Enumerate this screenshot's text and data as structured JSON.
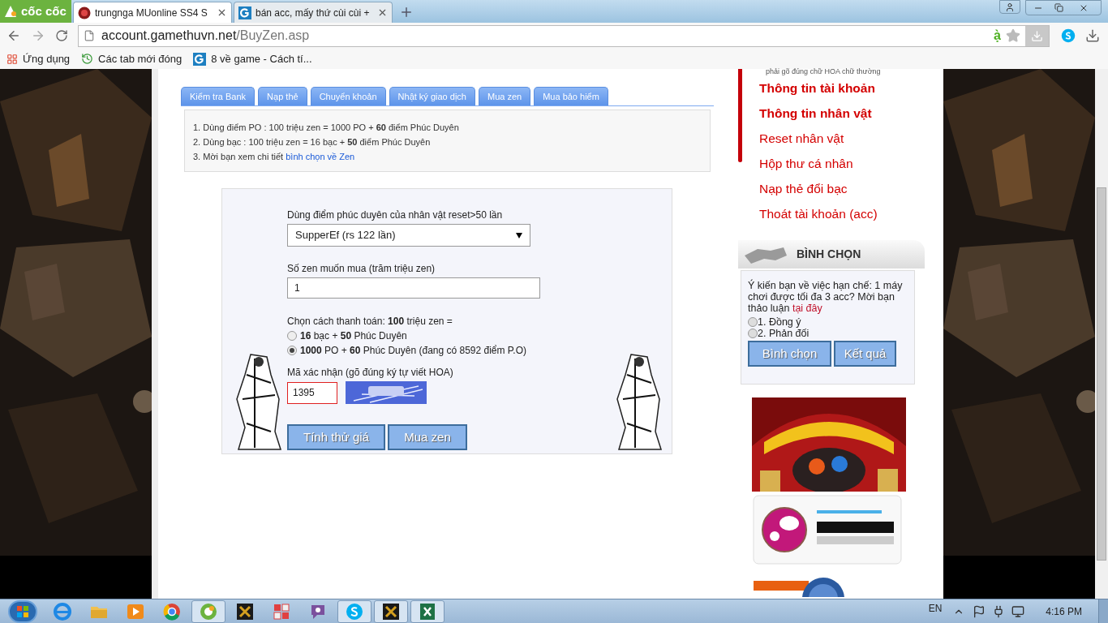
{
  "browser": {
    "logo": "cốc cốc",
    "tabs": [
      {
        "title": "trungnga MUonline SS4 S",
        "selected": true,
        "kind": "game"
      },
      {
        "title": "bán acc, mấy thứ cùi cùi +",
        "selected": false,
        "kind": "g"
      }
    ],
    "address": {
      "host": "account.gamethuvn.net",
      "path": "/BuyZen.asp"
    },
    "ime_indicator": "ạ̀",
    "bookmarks": [
      {
        "label": "Ứng dụng",
        "kind": "apps"
      },
      {
        "label": "Các tab mới đóng",
        "kind": "history"
      },
      {
        "label": "8 về game - Cách tí...",
        "kind": "g"
      }
    ]
  },
  "page_tabs": [
    {
      "label": "Kiểm tra Bank",
      "selected": false
    },
    {
      "label": "Nạp thẻ",
      "selected": false
    },
    {
      "label": "Chuyển khoản",
      "selected": false
    },
    {
      "label": "Nhật ký giao dịch",
      "selected": false
    },
    {
      "label": "Mua zen",
      "selected": false
    },
    {
      "label": "Mua bảo hiểm",
      "selected": false
    }
  ],
  "info": {
    "lines": [
      {
        "text": "1. Dùng điểm PO : 100 triệu zen = 1000 PO +  **60** điểm Phúc Duyên"
      },
      {
        "text": "2. Dùng bạc : 100 triệu zen = 16 bạc + **50** điểm Phúc Duyên"
      },
      {
        "text": "3. Mời bạn xem chi tiết",
        "link": "bình chọn về Zen"
      }
    ]
  },
  "form": {
    "character": {
      "label": "Dùng điểm phúc duyên của nhân vật reset>50 lần",
      "value": "SupperEf (rs 122 lần)"
    },
    "amount": {
      "label": "Số zen muốn mua (trăm triệu zen)",
      "value": "1"
    },
    "payment": {
      "label": "Chọn cách thanh toán: **100** triệu zen =",
      "options": [
        {
          "text": "**16** bạc + **50** Phúc Duyên",
          "selected": false
        },
        {
          "text": "**1000** PO + **60** Phúc Duyên (đang có 8592 điểm P.O)",
          "selected": true
        }
      ]
    },
    "captcha": {
      "label": "Mã xác nhận (gõ đúng ký tự viết HOA)",
      "value": "1395"
    },
    "buttons": [
      "Tính thử giá",
      "Mua zen"
    ]
  },
  "sidebar": {
    "note": "phải gõ đúng chữ HOA chữ thường",
    "menu": [
      {
        "label": "Thông tin tài khoản",
        "bold": true
      },
      {
        "label": "Thông tin nhân vật",
        "bold": true
      },
      {
        "label": "Reset nhân vật",
        "bold": false
      },
      {
        "label": "Hộp thư cá nhân",
        "bold": false
      },
      {
        "label": "Nạp thẻ đổi bạc",
        "bold": false
      },
      {
        "label": "Thoát tài khoản (acc)",
        "bold": false
      }
    ],
    "poll": {
      "title": "BÌNH CHỌN",
      "question": "Ý kiến bạn về việc hạn chế: 1 máy chơi được tối đa 3 acc? Mời bạn thảo luận",
      "link": "tại đây",
      "options": [
        {
          "label": "1. Đồng ý",
          "selected": false
        },
        {
          "label": "2. Phản đối",
          "selected": false
        }
      ],
      "buttons": [
        "Bình chọn",
        "Kết quả"
      ]
    }
  },
  "taskbar": {
    "apps": [
      {
        "kind": "ie",
        "active": false
      },
      {
        "kind": "folder",
        "active": false
      },
      {
        "kind": "media",
        "active": false
      },
      {
        "kind": "chrome",
        "active": false
      },
      {
        "kind": "coccoc",
        "active": true
      },
      {
        "kind": "game",
        "active": false
      },
      {
        "kind": "grid",
        "active": false
      },
      {
        "kind": "viber",
        "active": false
      },
      {
        "kind": "skype",
        "active": true
      },
      {
        "kind": "game",
        "active": true
      },
      {
        "kind": "excel",
        "active": true
      }
    ],
    "language": "EN",
    "time": "4:16 PM"
  }
}
